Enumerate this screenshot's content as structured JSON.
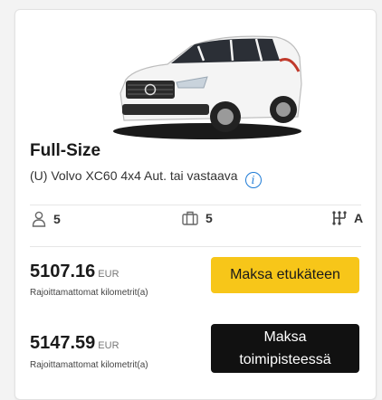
{
  "car": {
    "category": "Full-Size",
    "model": "(U) Volvo XC60 4x4 Aut. tai vastaava",
    "info_icon_glyph": "i"
  },
  "features": {
    "seats": "5",
    "luggage": "5",
    "transmission": "A"
  },
  "offers": [
    {
      "price": "5107.16",
      "currency": "EUR",
      "mileage": "Rajoittamattomat kilometrit(a)",
      "button": "Maksa etukäteen"
    },
    {
      "price": "5147.59",
      "currency": "EUR",
      "mileage": "Rajoittamattomat kilometrit(a)",
      "button": "Maksa toimipisteessä"
    }
  ],
  "colors": {
    "pay_now": "#f7c619",
    "pay_later": "#111111",
    "info": "#1e7bd6"
  }
}
